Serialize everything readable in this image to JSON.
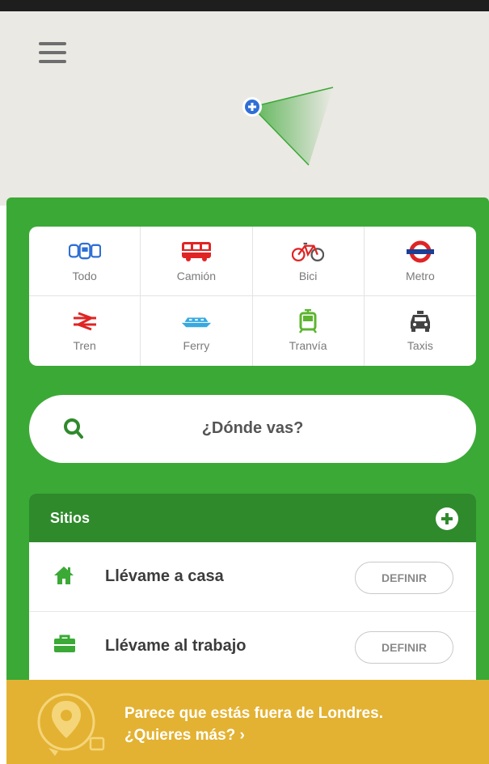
{
  "map": {
    "menu_icon": "hamburger-menu-icon",
    "location_marker": "current-location-icon"
  },
  "transport_modes": [
    {
      "label": "Todo",
      "icon": "all-transport-icon"
    },
    {
      "label": "Camión",
      "icon": "bus-icon"
    },
    {
      "label": "Bici",
      "icon": "bicycle-icon"
    },
    {
      "label": "Metro",
      "icon": "underground-roundel-icon"
    },
    {
      "label": "Tren",
      "icon": "national-rail-icon"
    },
    {
      "label": "Ferry",
      "icon": "ferry-icon"
    },
    {
      "label": "Tranvía",
      "icon": "tram-icon"
    },
    {
      "label": "Taxis",
      "icon": "taxi-icon"
    }
  ],
  "search": {
    "placeholder": "¿Dónde vas?"
  },
  "places": {
    "title": "Sitios",
    "items": [
      {
        "label": "Llévame a casa",
        "button": "DEFINIR",
        "icon": "home-icon"
      },
      {
        "label": "Llévame al trabajo",
        "button": "DEFINIR",
        "icon": "briefcase-icon"
      }
    ]
  },
  "banner": {
    "text": "Parece que estás fuera de Londres. ¿Quieres más? ›",
    "icon": "map-pin-globe-icon"
  },
  "colors": {
    "primary_green": "#3ba936",
    "header_green": "#2f8a2c",
    "banner_yellow": "#e3b232"
  }
}
